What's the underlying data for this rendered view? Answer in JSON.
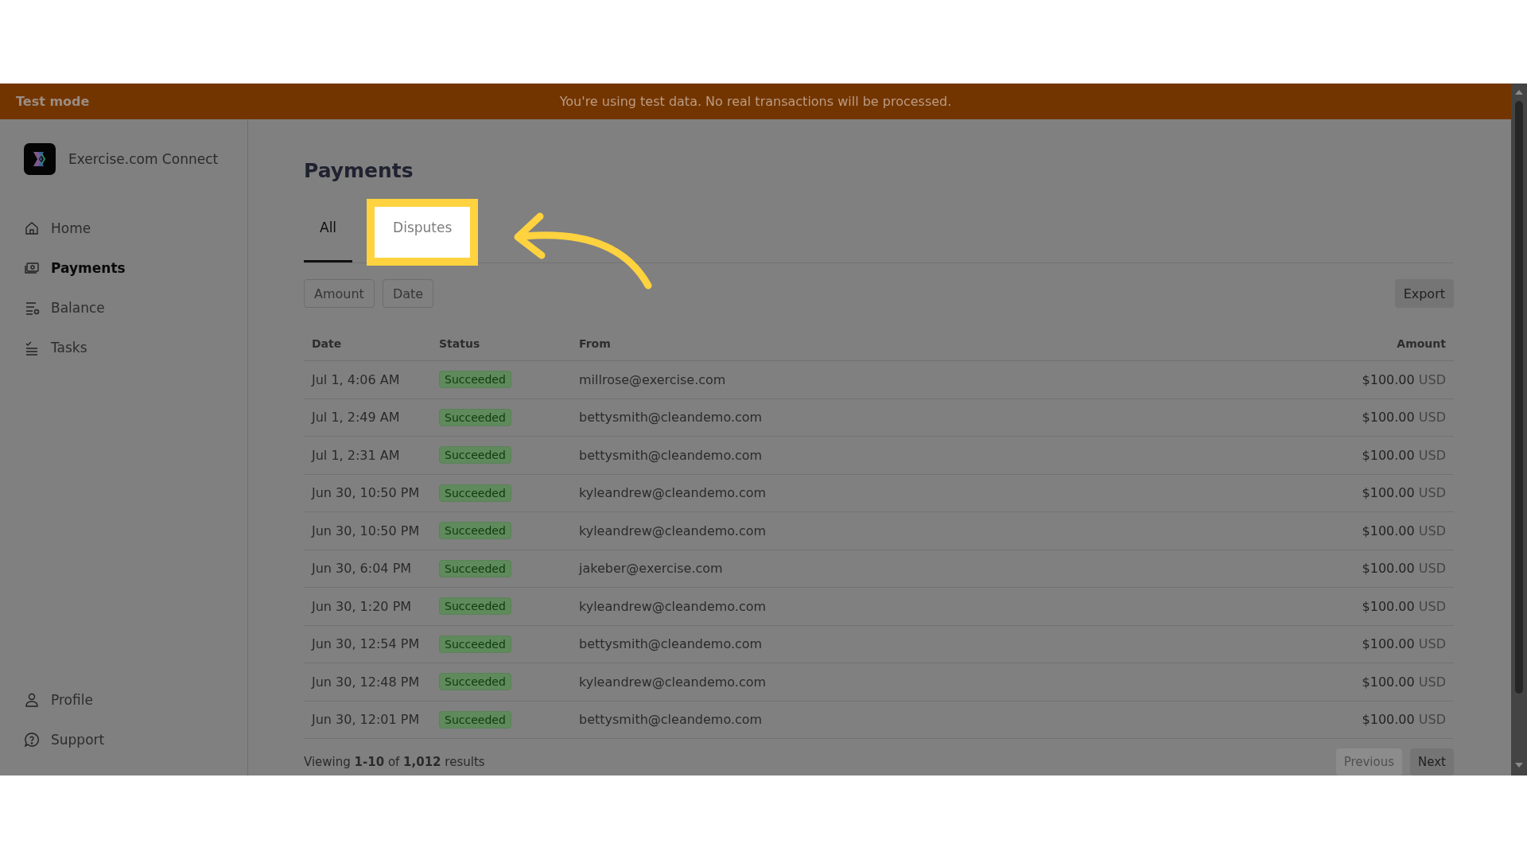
{
  "banner": {
    "label": "Test mode",
    "message": "You're using test data. No real transactions will be processed."
  },
  "sidebar": {
    "brand": "Exercise.com Connect",
    "items": [
      {
        "label": "Home",
        "selected": false
      },
      {
        "label": "Payments",
        "selected": true
      },
      {
        "label": "Balance",
        "selected": false
      },
      {
        "label": "Tasks",
        "selected": false
      }
    ],
    "footer_items": [
      {
        "label": "Profile",
        "selected": false
      },
      {
        "label": "Support",
        "selected": false
      }
    ]
  },
  "page": {
    "title": "Payments",
    "tabs": [
      {
        "label": "All",
        "selected": true,
        "highlighted": false
      },
      {
        "label": "Disputes",
        "selected": false,
        "highlighted": true
      }
    ],
    "filters": [
      "Amount",
      "Date"
    ],
    "export": "Export"
  },
  "table": {
    "columns": [
      "Date",
      "Status",
      "From",
      "Amount"
    ],
    "rows": [
      {
        "date": "Jul 1, 4:06 AM",
        "status": "Succeeded",
        "from": "millrose@exercise.com",
        "amount": "$100.00",
        "currency": "USD"
      },
      {
        "date": "Jul 1, 2:49 AM",
        "status": "Succeeded",
        "from": "bettysmith@cleandemo.com",
        "amount": "$100.00",
        "currency": "USD"
      },
      {
        "date": "Jul 1, 2:31 AM",
        "status": "Succeeded",
        "from": "bettysmith@cleandemo.com",
        "amount": "$100.00",
        "currency": "USD"
      },
      {
        "date": "Jun 30, 10:50 PM",
        "status": "Succeeded",
        "from": "kyleandrew@cleandemo.com",
        "amount": "$100.00",
        "currency": "USD"
      },
      {
        "date": "Jun 30, 10:50 PM",
        "status": "Succeeded",
        "from": "kyleandrew@cleandemo.com",
        "amount": "$100.00",
        "currency": "USD"
      },
      {
        "date": "Jun 30, 6:04 PM",
        "status": "Succeeded",
        "from": "jakeber@exercise.com",
        "amount": "$100.00",
        "currency": "USD"
      },
      {
        "date": "Jun 30, 1:20 PM",
        "status": "Succeeded",
        "from": "kyleandrew@cleandemo.com",
        "amount": "$100.00",
        "currency": "USD"
      },
      {
        "date": "Jun 30, 12:54 PM",
        "status": "Succeeded",
        "from": "bettysmith@cleandemo.com",
        "amount": "$100.00",
        "currency": "USD"
      },
      {
        "date": "Jun 30, 12:48 PM",
        "status": "Succeeded",
        "from": "kyleandrew@cleandemo.com",
        "amount": "$100.00",
        "currency": "USD"
      },
      {
        "date": "Jun 30, 12:01 PM",
        "status": "Succeeded",
        "from": "bettysmith@cleandemo.com",
        "amount": "$100.00",
        "currency": "USD"
      }
    ]
  },
  "pagination": {
    "summary": "Viewing **1-10** of **1,012** results",
    "buttons": [
      {
        "label": "Previous",
        "disabled": true
      },
      {
        "label": "Next",
        "disabled": false
      }
    ]
  }
}
